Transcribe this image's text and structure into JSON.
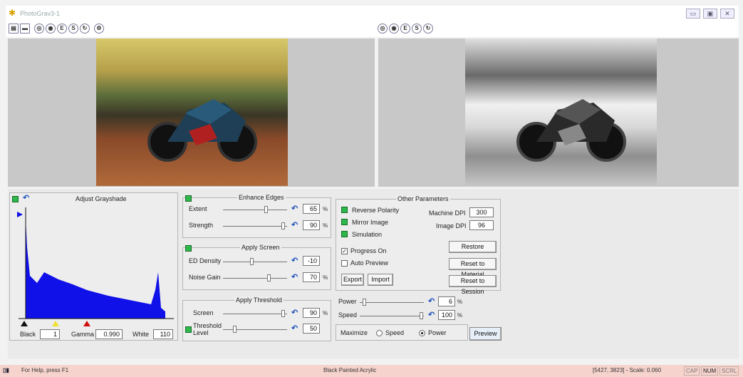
{
  "app": {
    "title": "PhotoGrav3-1"
  },
  "window_buttons": [
    "minimize",
    "restore",
    "close"
  ],
  "toolbar_left": {
    "icons": [
      "view-split-icon",
      "view-single-icon",
      "zoom-in-icon",
      "zoom-fit-icon",
      "equalize-icon",
      "sharpen-icon",
      "refresh-icon",
      "settings-icon"
    ]
  },
  "toolbar_right": {
    "icons": [
      "zoom-in-icon",
      "zoom-fit-icon",
      "equalize-icon",
      "sharpen-icon",
      "refresh-icon"
    ]
  },
  "grayshade": {
    "title": "Adjust Grayshade",
    "black_label": "Black",
    "black_value": "1",
    "gamma_label": "Gamma",
    "gamma_value": "0.990",
    "white_label": "White",
    "white_value": "110"
  },
  "enhance_edges": {
    "title": "Enhance Edges",
    "extent_label": "Extent",
    "extent_value": "65",
    "strength_label": "Strength",
    "strength_value": "90",
    "unit": "%"
  },
  "apply_screen": {
    "title": "Apply Screen",
    "density_label": "ED Density",
    "density_value": "-10",
    "noise_label": "Noise Gain",
    "noise_value": "70",
    "unit": "%"
  },
  "apply_threshold": {
    "title": "Apply Threshold",
    "screen_label": "Screen",
    "screen_value": "90",
    "level_label_1": "Threshold",
    "level_label_2": "Level",
    "level_value": "50",
    "unit": "%"
  },
  "other_params": {
    "title": "Other Parameters",
    "reverse_polarity": "Reverse Polarity",
    "mirror_image": "Mirror Image",
    "simulation": "Simulation",
    "machine_dpi_label": "Machine DPI",
    "machine_dpi_value": "300",
    "image_dpi_label": "Image DPI",
    "image_dpi_value": "96",
    "progress_on": "Progress On",
    "auto_preview": "Auto Preview",
    "restore": "Restore",
    "reset_material": "Reset to Material",
    "reset_session": "Reset to Session",
    "export": "Export",
    "import": "Import"
  },
  "power_speed": {
    "power_label": "Power",
    "power_value": "6",
    "speed_label": "Speed",
    "speed_value": "100",
    "unit": "%",
    "maximize_label": "Maximize",
    "speed_option": "Speed",
    "power_option": "Power",
    "selected": "Power",
    "preview": "Preview"
  },
  "status": {
    "help": "For Help, press F1",
    "material": "Black Painted Acrylic",
    "coords": "[5427, 3823] - Scale: 0.060",
    "cap": "CAP",
    "num": "NUM",
    "scrl": "SCRL"
  },
  "colors": {
    "histogram": "#1010e8",
    "status_bg": "#f6d3cd",
    "led": "#2cb94a"
  }
}
